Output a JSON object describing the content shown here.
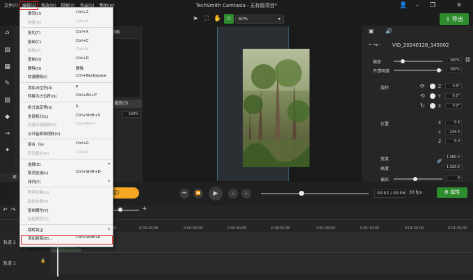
{
  "titlebar": {
    "menus": [
      "文件(F)",
      "编辑(E)",
      "修改(M)",
      "视图(V)",
      "导出(S)",
      "帮助(H)"
    ],
    "app_title": "TechSmith Camtasia - 无标题项目*"
  },
  "toolbar": {
    "zoom_value": "60%",
    "export_label": "导出"
  },
  "edit_menu": {
    "items": [
      {
        "label": "撤消(U)",
        "shortcut": "Ctrl+Z",
        "disabled": false
      },
      {
        "label": "恢复(R)",
        "shortcut": "Ctrl+Y",
        "disabled": true
      },
      {
        "sep": true
      },
      {
        "label": "剪切(T)",
        "shortcut": "Ctrl+X",
        "disabled": false
      },
      {
        "label": "复制(C)",
        "shortcut": "Ctrl+C",
        "disabled": false
      },
      {
        "label": "粘贴(P)",
        "shortcut": "Ctrl+V",
        "disabled": true
      },
      {
        "label": "复制(D)",
        "shortcut": "Ctrl+D",
        "disabled": false
      },
      {
        "label": "删除(D)",
        "shortcut": "删除",
        "disabled": false
      },
      {
        "label": "纹波删除(I)",
        "shortcut": "Ctrl+Backspace",
        "disabled": false
      },
      {
        "sep": true
      },
      {
        "label": "添加占位符(A)",
        "shortcut": "P",
        "disabled": false
      },
      {
        "label": "转换为占位符(O)",
        "shortcut": "Ctrl+Alt+P",
        "disabled": false
      },
      {
        "sep": true
      },
      {
        "label": "拆分选定项(S)",
        "shortcut": "S",
        "disabled": false
      },
      {
        "label": "全部拆分(L)",
        "shortcut": "Ctrl+Shift+S",
        "disabled": false
      },
      {
        "label": "拼接所选媒体(H)",
        "shortcut": "Ctrl+Alt+I",
        "disabled": true
      },
      {
        "label": "分开音频和视频(V)",
        "shortcut": "",
        "disabled": false
      },
      {
        "sep": true
      },
      {
        "label": "组合（G)",
        "shortcut": "Ctrl+G",
        "disabled": false
      },
      {
        "label": "取消组合(N)",
        "shortcut": "Ctrl+U",
        "disabled": true
      },
      {
        "sep": true
      },
      {
        "label": "选择(E)",
        "shortcut": "",
        "disabled": false,
        "submenu": true
      },
      {
        "label": "取消全选(L)",
        "shortcut": "Ctrl+Shift+D",
        "disabled": false
      },
      {
        "label": "排列(Y)",
        "shortcut": "",
        "disabled": false,
        "submenu": true
      },
      {
        "sep": true
      },
      {
        "label": "程序效果(G)",
        "shortcut": "",
        "disabled": true
      },
      {
        "label": "粘贴效果(P)",
        "shortcut": "",
        "disabled": true
      },
      {
        "label": "复制属性(Y)",
        "shortcut": "",
        "disabled": false
      },
      {
        "label": "粘贴属性(A)",
        "shortcut": "",
        "disabled": true
      },
      {
        "sep": true
      },
      {
        "label": "跳转到(J)",
        "shortcut": "",
        "disabled": false,
        "submenu": true
      },
      {
        "label": "添加到库(B)...",
        "shortcut": "Ctrl+Shift+A",
        "disabled": false
      },
      {
        "sep": true
      },
      {
        "label": "首选项(F)...",
        "shortcut": "Ctrl+,",
        "disabled": false
      }
    ]
  },
  "left_panel": {
    "title_fragment": "动画",
    "apply_button": "播放(S)",
    "percent_value": "100%"
  },
  "right_panel": {
    "clip_name": "VID_20240128_145002",
    "scale_label": "缩放",
    "scale_value": "100%",
    "opacity_label": "不透明度",
    "opacity_value": "100%",
    "rotation_label": "旋转",
    "rotation": [
      {
        "axis": "Z",
        "value": "0.0°"
      },
      {
        "axis": "Y",
        "value": "0.0°"
      },
      {
        "axis": "X",
        "value": "0.0°"
      }
    ],
    "position_label": "位置",
    "position": [
      {
        "axis": "X",
        "value": "0.4"
      },
      {
        "axis": "Y",
        "value": "-144.0"
      },
      {
        "axis": "Z",
        "value": "0.0"
      }
    ],
    "width_label": "宽度",
    "width_value": "1,080.0",
    "height_label": "高度",
    "height_value": "1,920.0",
    "corner_label": "偏衣",
    "corner_value": "0",
    "properties_button": "属性"
  },
  "playback": {
    "time_current": "00:02",
    "time_total": "00:06",
    "fps": "30 fps",
    "trial_badge": "买!"
  },
  "timeline": {
    "tracks": [
      "轨道 2",
      "轨道 1"
    ],
    "left_tab": "更",
    "ruler": [
      "0:00:10;00",
      "0:00:20;00",
      "0:00:30;00",
      "0:00:40;00",
      "0:00:50;00",
      "0:01:00;00",
      "0:01:10;00",
      "0:01:20;00",
      "0:01:30;00"
    ]
  },
  "colors": {
    "accent_green": "#2e8b2e",
    "highlight_red": "#e02020",
    "trial_orange": "#f5a623"
  }
}
